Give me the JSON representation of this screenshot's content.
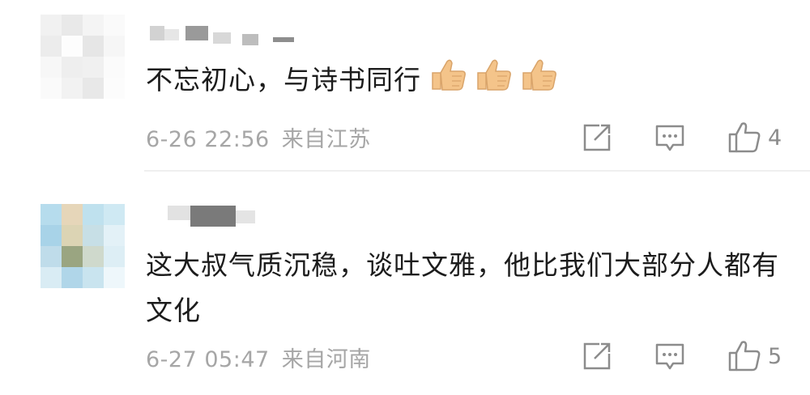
{
  "comments": [
    {
      "text": "不忘初心，与诗书同行",
      "emoji": [
        "thumbs-up",
        "thumbs-up",
        "thumbs-up"
      ],
      "date": "6-26 22:56",
      "location": "来自江苏",
      "likes": "4"
    },
    {
      "text": "这大叔气质沉稳，谈吐文雅，他比我们大部分人都有文化",
      "date": "6-27 05:47",
      "location": "来自河南",
      "likes": "5"
    }
  ],
  "icons": {
    "share": "share-icon",
    "reply": "comment-icon",
    "like": "thumbs-up-icon"
  },
  "colors": {
    "text": "#1c1c1c",
    "meta": "#a6a6a6",
    "icon": "#8c8c8c",
    "emoji": "#f4c48a"
  }
}
